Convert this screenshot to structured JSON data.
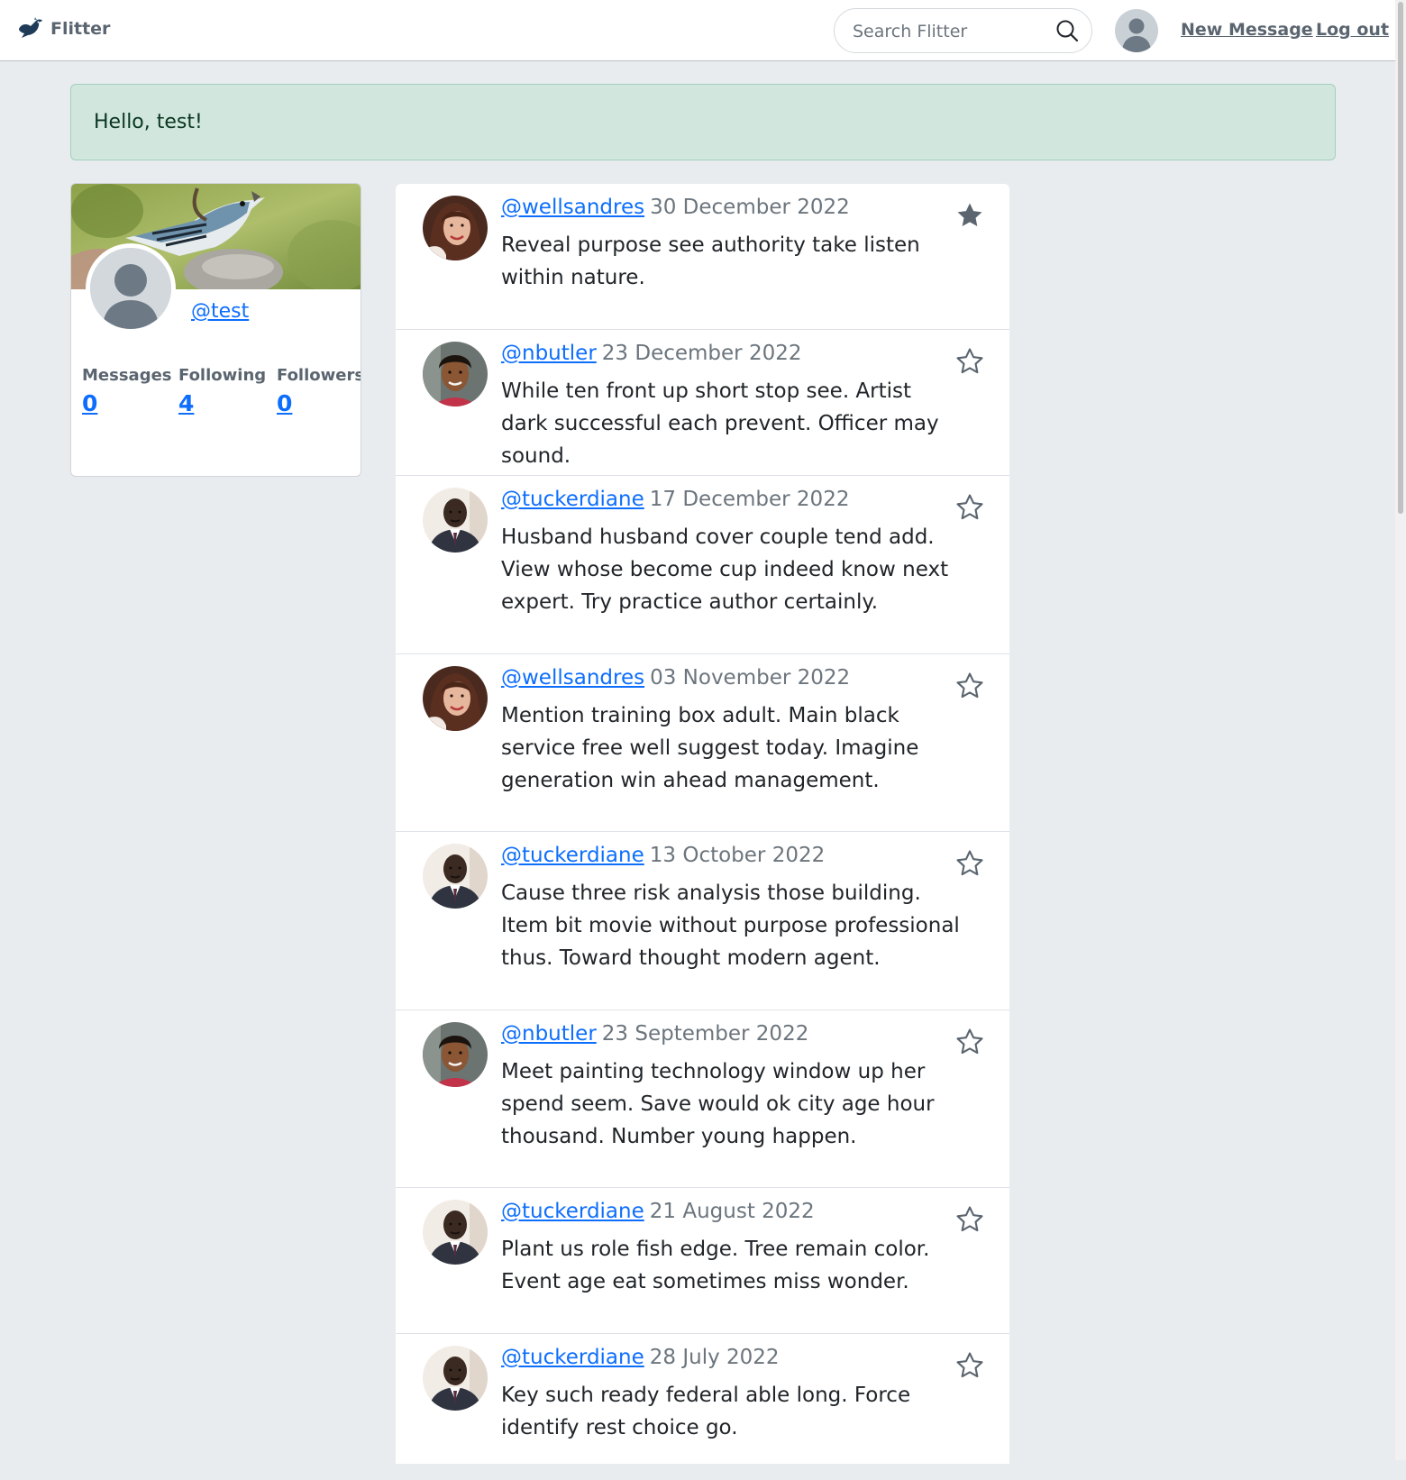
{
  "navbar": {
    "brand": "Flitter",
    "search_placeholder": "Search Flitter",
    "new_message": "New Message",
    "log_out": "Log out"
  },
  "alert": {
    "text": "Hello, test!"
  },
  "profile": {
    "handle": "@test",
    "stats": [
      {
        "label": "Messages",
        "value": "0"
      },
      {
        "label": "Following",
        "value": "4"
      },
      {
        "label": "Followers",
        "value": "0"
      }
    ]
  },
  "messages": [
    {
      "user": "@wellsandres",
      "date": "30 December 2022",
      "text": "Reveal purpose see authority take listen within nature.",
      "starred": true,
      "avatar": "woman-brown-hair"
    },
    {
      "user": "@nbutler",
      "date": "23 December 2022",
      "text": "While ten front up short stop see. Artist dark successful each prevent. Officer may sound.",
      "starred": false,
      "avatar": "man-curly-hair"
    },
    {
      "user": "@tuckerdiane",
      "date": "17 December 2022",
      "text": "Husband husband cover couple tend add. View whose become cup indeed know next expert. Try practice author certainly.",
      "starred": false,
      "avatar": "man-suit"
    },
    {
      "user": "@wellsandres",
      "date": "03 November 2022",
      "text": "Mention training box adult. Main black service free well suggest today. Imagine generation win ahead management.",
      "starred": false,
      "avatar": "woman-brown-hair"
    },
    {
      "user": "@tuckerdiane",
      "date": "13 October 2022",
      "text": "Cause three risk analysis those building. Item bit movie without purpose professional thus. Toward thought modern agent.",
      "starred": false,
      "avatar": "man-suit"
    },
    {
      "user": "@nbutler",
      "date": "23 September 2022",
      "text": "Meet painting technology window up her spend seem. Save would ok city age hour thousand. Number young happen.",
      "starred": false,
      "avatar": "man-curly-hair"
    },
    {
      "user": "@tuckerdiane",
      "date": "21 August 2022",
      "text": "Plant us role fish edge. Tree remain color. Event age eat sometimes miss wonder.",
      "starred": false,
      "avatar": "man-suit"
    },
    {
      "user": "@tuckerdiane",
      "date": "28 July 2022",
      "text": "Key such ready federal able long. Force identify rest choice go.",
      "starred": false,
      "avatar": "man-suit"
    }
  ]
}
